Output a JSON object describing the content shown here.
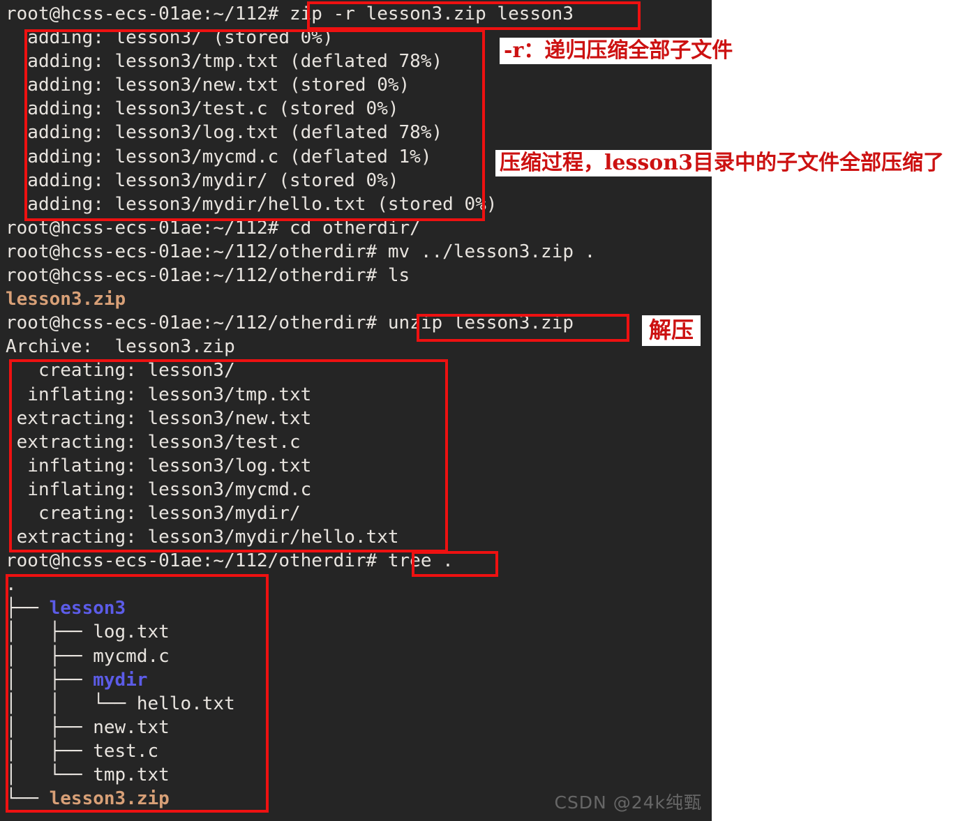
{
  "theme": {
    "terminal_bg": "#252525",
    "page_bg": "#ffffff",
    "text_color": "#e8e4df",
    "dir_color": "#5c5ce8",
    "archive_color": "#d8a077",
    "highlight_color": "#ee1111",
    "annotation_color": "#cc1111"
  },
  "terminal": {
    "prompts": {
      "p112": "root@hcss-ecs-01ae:~/112# ",
      "potherdir": "root@hcss-ecs-01ae:~/112/otherdir# "
    },
    "lines": [
      {
        "id": "l01",
        "kind": "prompt-cmd",
        "prompt": "root@hcss-ecs-01ae:~/112# ",
        "command": "zip -r lesson3.zip lesson3"
      },
      {
        "id": "l02",
        "kind": "output",
        "text": "  adding: lesson3/ (stored 0%)"
      },
      {
        "id": "l03",
        "kind": "output",
        "text": "  adding: lesson3/tmp.txt (deflated 78%)"
      },
      {
        "id": "l04",
        "kind": "output",
        "text": "  adding: lesson3/new.txt (stored 0%)"
      },
      {
        "id": "l05",
        "kind": "output",
        "text": "  adding: lesson3/test.c (stored 0%)"
      },
      {
        "id": "l06",
        "kind": "output",
        "text": "  adding: lesson3/log.txt (deflated 78%)"
      },
      {
        "id": "l07",
        "kind": "output",
        "text": "  adding: lesson3/mycmd.c (deflated 1%)"
      },
      {
        "id": "l08",
        "kind": "output",
        "text": "  adding: lesson3/mydir/ (stored 0%)"
      },
      {
        "id": "l09",
        "kind": "output",
        "text": "  adding: lesson3/mydir/hello.txt (stored 0%)"
      },
      {
        "id": "l10",
        "kind": "prompt-cmd",
        "prompt": "root@hcss-ecs-01ae:~/112# ",
        "command": "cd otherdir/"
      },
      {
        "id": "l11",
        "kind": "prompt-cmd",
        "prompt": "root@hcss-ecs-01ae:~/112/otherdir# ",
        "command": "mv ../lesson3.zip ."
      },
      {
        "id": "l12",
        "kind": "prompt-cmd",
        "prompt": "root@hcss-ecs-01ae:~/112/otherdir# ",
        "command": "ls"
      },
      {
        "id": "l13",
        "kind": "archive",
        "text": "lesson3.zip"
      },
      {
        "id": "l14",
        "kind": "prompt-cmd",
        "prompt": "root@hcss-ecs-01ae:~/112/otherdir# ",
        "command": "unzip lesson3.zip"
      },
      {
        "id": "l15",
        "kind": "output",
        "text": "Archive:  lesson3.zip"
      },
      {
        "id": "l16",
        "kind": "output",
        "text": "   creating: lesson3/"
      },
      {
        "id": "l17",
        "kind": "output",
        "text": "  inflating: lesson3/tmp.txt"
      },
      {
        "id": "l18",
        "kind": "output",
        "text": " extracting: lesson3/new.txt"
      },
      {
        "id": "l19",
        "kind": "output",
        "text": " extracting: lesson3/test.c"
      },
      {
        "id": "l20",
        "kind": "output",
        "text": "  inflating: lesson3/log.txt"
      },
      {
        "id": "l21",
        "kind": "output",
        "text": "  inflating: lesson3/mycmd.c"
      },
      {
        "id": "l22",
        "kind": "output",
        "text": "   creating: lesson3/mydir/"
      },
      {
        "id": "l23",
        "kind": "output",
        "text": " extracting: lesson3/mydir/hello.txt"
      },
      {
        "id": "l24",
        "kind": "prompt-cmd",
        "prompt": "root@hcss-ecs-01ae:~/112/otherdir# ",
        "command": "tree ."
      },
      {
        "id": "l25",
        "kind": "output",
        "text": "."
      },
      {
        "id": "l26",
        "kind": "tree-dir",
        "prefix": "├── ",
        "name": "lesson3"
      },
      {
        "id": "l27",
        "kind": "output",
        "text": "│   ├── log.txt"
      },
      {
        "id": "l28",
        "kind": "output",
        "text": "│   ├── mycmd.c"
      },
      {
        "id": "l29",
        "kind": "tree-dir",
        "prefix": "│   ├── ",
        "name": "mydir"
      },
      {
        "id": "l30",
        "kind": "output",
        "text": "│   │   └── hello.txt"
      },
      {
        "id": "l31",
        "kind": "output",
        "text": "│   ├── new.txt"
      },
      {
        "id": "l32",
        "kind": "output",
        "text": "│   ├── test.c"
      },
      {
        "id": "l33",
        "kind": "output",
        "text": "│   └── tmp.txt"
      },
      {
        "id": "l34",
        "kind": "tree-archive",
        "prefix": "└── ",
        "name": "lesson3.zip"
      }
    ]
  },
  "annotations": {
    "recursive": "-r：递归压缩全部子文件",
    "process": "压缩过程，lesson3目录中的子文件全部压缩了",
    "unzip": "解压"
  },
  "highlight_boxes": [
    {
      "id": "hb-zip-command",
      "label": "zip -r lesson3.zip lesson3"
    },
    {
      "id": "hb-adding-output",
      "label": "adding output block"
    },
    {
      "id": "hb-unzip-command",
      "label": "unzip lesson3.zip"
    },
    {
      "id": "hb-unzip-output",
      "label": "unzip extraction block"
    },
    {
      "id": "hb-tree-command",
      "label": "tree ."
    },
    {
      "id": "hb-tree-output",
      "label": "tree output block"
    }
  ],
  "watermark": "CSDN @24k纯甄"
}
